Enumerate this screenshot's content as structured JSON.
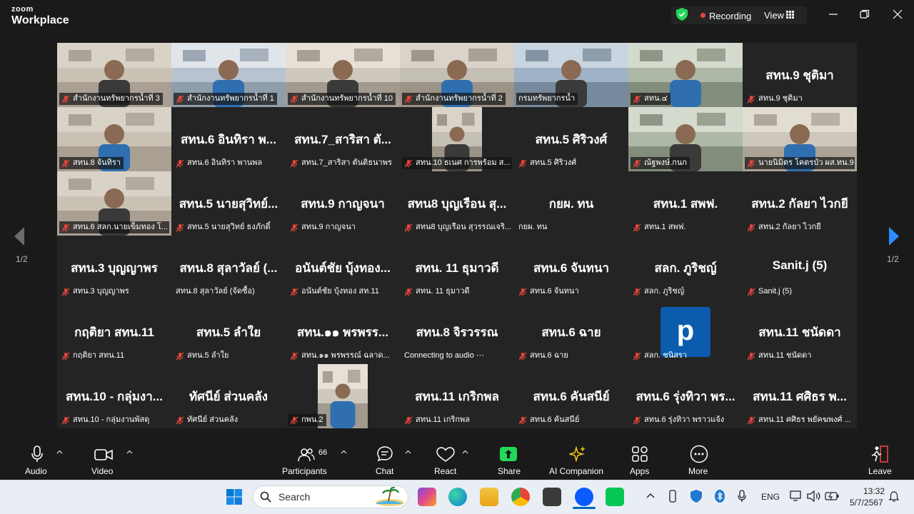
{
  "app": {
    "logo_line1": "zoom",
    "logo_line2": "Workplace"
  },
  "titlebar": {
    "recording_label": "Recording",
    "view_label": "View"
  },
  "gallery": {
    "page_label_left": "1/2",
    "page_label_right": "1/2",
    "tiles": [
      {
        "name": "",
        "caption": "สำนักงานทรัพยากรน้ำที่ 3",
        "muted": true,
        "video": true
      },
      {
        "name": "",
        "caption": "สำนักงานทรัพยากรน้ำที่ 1",
        "muted": true,
        "video": true
      },
      {
        "name": "",
        "caption": "สำนักงานทรัพยากรน้ำที่ 10",
        "muted": true,
        "video": true
      },
      {
        "name": "",
        "caption": "สำนักงานทรัพยากรน้ำที่ 2",
        "muted": true,
        "video": true
      },
      {
        "name": "",
        "caption": "กรมทรัพยากรน้ำ",
        "muted": false,
        "video": true,
        "active": true
      },
      {
        "name": "",
        "caption": "สทน.๔",
        "muted": true,
        "video": true
      },
      {
        "name": "สทน.9 ชุติมา",
        "caption": "สทน.9 ชุติมา",
        "muted": true,
        "video": false
      },
      {
        "name": "",
        "caption": "สทน.8 จันทิรา",
        "muted": true,
        "video": true
      },
      {
        "name": "สทน.6 อินทิรา พ...",
        "caption": "สทน.6 อินทิรา พานพล",
        "muted": true,
        "video": false
      },
      {
        "name": "สทน.7_สาริสา ตั...",
        "caption": "สทน.7_สาริสา ตันติธนาพร",
        "muted": true,
        "video": false
      },
      {
        "name": "",
        "caption": "สทน.10 ธเนศ การพร้อม ส...",
        "muted": true,
        "video": true,
        "narrow": true
      },
      {
        "name": "สทน.5 ศิริวงศ์",
        "caption": "สทน.5 ศิริวงศ์",
        "muted": true,
        "video": false
      },
      {
        "name": "",
        "caption": "ณัฐพงษ์.กนก",
        "muted": true,
        "video": true
      },
      {
        "name": "",
        "caption": "นายนิมิตร โคตรบัว ผส.ทน.9",
        "muted": true,
        "video": true
      },
      {
        "name": "",
        "caption": "สทน.6 สลก.นายเข็มทอง โ...",
        "muted": true,
        "video": true
      },
      {
        "name": "สทน.5 นายสุวิทย์...",
        "caption": "สทน.5 นายสุวิทย์ ธงภักดิ์",
        "muted": true,
        "video": false
      },
      {
        "name": "สทน.9 กาญจนา",
        "caption": "สทน.9 กาญจนา",
        "muted": true,
        "video": false
      },
      {
        "name": "สทน8 บุญเรือน สุ...",
        "caption": "สทน8 บุญเรือน สุวรรณเจริ...",
        "muted": true,
        "video": false
      },
      {
        "name": "กยผ. ทน",
        "caption": "กยผ. ทน",
        "muted": false,
        "video": false
      },
      {
        "name": "สทน.1 สพฟ.",
        "caption": "สทน.1 สพฟ.",
        "muted": true,
        "video": false
      },
      {
        "name": "สทน.2 กัลยา ไวกยี",
        "caption": "สทน.2 กัลยา ไวกยี",
        "muted": true,
        "video": false
      },
      {
        "name": "สทน.3 บุญญาพร",
        "caption": "สทน.3 บุญญาพร",
        "muted": true,
        "video": false
      },
      {
        "name": "สทน.8 สุลาวัลย์ (...",
        "caption": "สทน.8 สุลาวัลย์ (จัดซื้อ)",
        "muted": false,
        "video": false
      },
      {
        "name": "อนันต์ชัย บุ้งทอง...",
        "caption": "อนันต์ชัย บุ้งทอง สท.11",
        "muted": true,
        "video": false
      },
      {
        "name": "สทน. 11 ธุมาวดี",
        "caption": "สทน. 11 ธุมาวดี",
        "muted": true,
        "video": false
      },
      {
        "name": "สทน.6 จันทนา",
        "caption": "สทน.6 จันทนา",
        "muted": true,
        "video": false
      },
      {
        "name": "สลก. ภูริชญ์",
        "caption": "สลก. ภูริชญ์",
        "muted": true,
        "video": false
      },
      {
        "name": "Sanit.j (5)",
        "caption": "Sanit.j (5)",
        "muted": true,
        "video": false
      },
      {
        "name": "กฤติยา สทน.11",
        "caption": "กฤติยา สทน.11",
        "muted": true,
        "video": false
      },
      {
        "name": "สทน.5 ลำใย",
        "caption": "สทน.5 ลำใย",
        "muted": true,
        "video": false
      },
      {
        "name": "สทน.๑๑ พรพรร...",
        "caption": "สทน.๑๑ พรพรรณ์ ฉลาด...",
        "muted": true,
        "video": false
      },
      {
        "name": "สทน.8 จิรวรรณ",
        "caption": "Connecting to audio ⋯",
        "muted": false,
        "video": false
      },
      {
        "name": "สทน.6 ฉาย",
        "caption": "สทน.6 ฉาย",
        "muted": true,
        "video": false
      },
      {
        "name": "",
        "caption": "สลก. ชนิสรา",
        "muted": true,
        "video": false,
        "avatar": "p"
      },
      {
        "name": "สทน.11 ชนัดดา",
        "caption": "สทน.11 ชนัดดา",
        "muted": true,
        "video": false
      },
      {
        "name": "สทน.10 - กลุ่มงา...",
        "caption": "สทน.10 - กลุ่มงานพัสดุ",
        "muted": true,
        "video": false
      },
      {
        "name": "ทัศนีย์ ส่วนคลัง",
        "caption": "ทัศนีย์ ส่วนคลัง",
        "muted": true,
        "video": false
      },
      {
        "name": "",
        "caption": "กพน.2",
        "muted": true,
        "video": true,
        "narrow": true
      },
      {
        "name": "สทน.11 เกริกพล",
        "caption": "สทน.11 เกริกพล",
        "muted": true,
        "video": false
      },
      {
        "name": "สทน.6 คันสนีย์",
        "caption": "สทน.6 คันสนีย์",
        "muted": true,
        "video": false
      },
      {
        "name": "สทน.6 รุ่งทิวา พร...",
        "caption": "สทน.6 รุ่งทิวา พราวแจ้ง",
        "muted": true,
        "video": false
      },
      {
        "name": "สทน.11 ศศิธร พ...",
        "caption": "สทน.11 ศศิธร พยัคฆพงศ์ ...",
        "muted": true,
        "video": false
      }
    ]
  },
  "toolbar": {
    "audio_label": "Audio",
    "video_label": "Video",
    "participants_label": "Participants",
    "participants_count": "66",
    "chat_label": "Chat",
    "react_label": "React",
    "share_label": "Share",
    "ai_label": "AI Companion",
    "apps_label": "Apps",
    "more_label": "More",
    "leave_label": "Leave"
  },
  "taskbar": {
    "search_placeholder": "Search",
    "language": "ENG",
    "time": "13:32",
    "date": "5/7/2567"
  },
  "colors": {
    "accent_green": "#23d959",
    "record_red": "#e8453c",
    "muted_red": "#e8453c",
    "avatar_blue": "#0b5cad"
  }
}
